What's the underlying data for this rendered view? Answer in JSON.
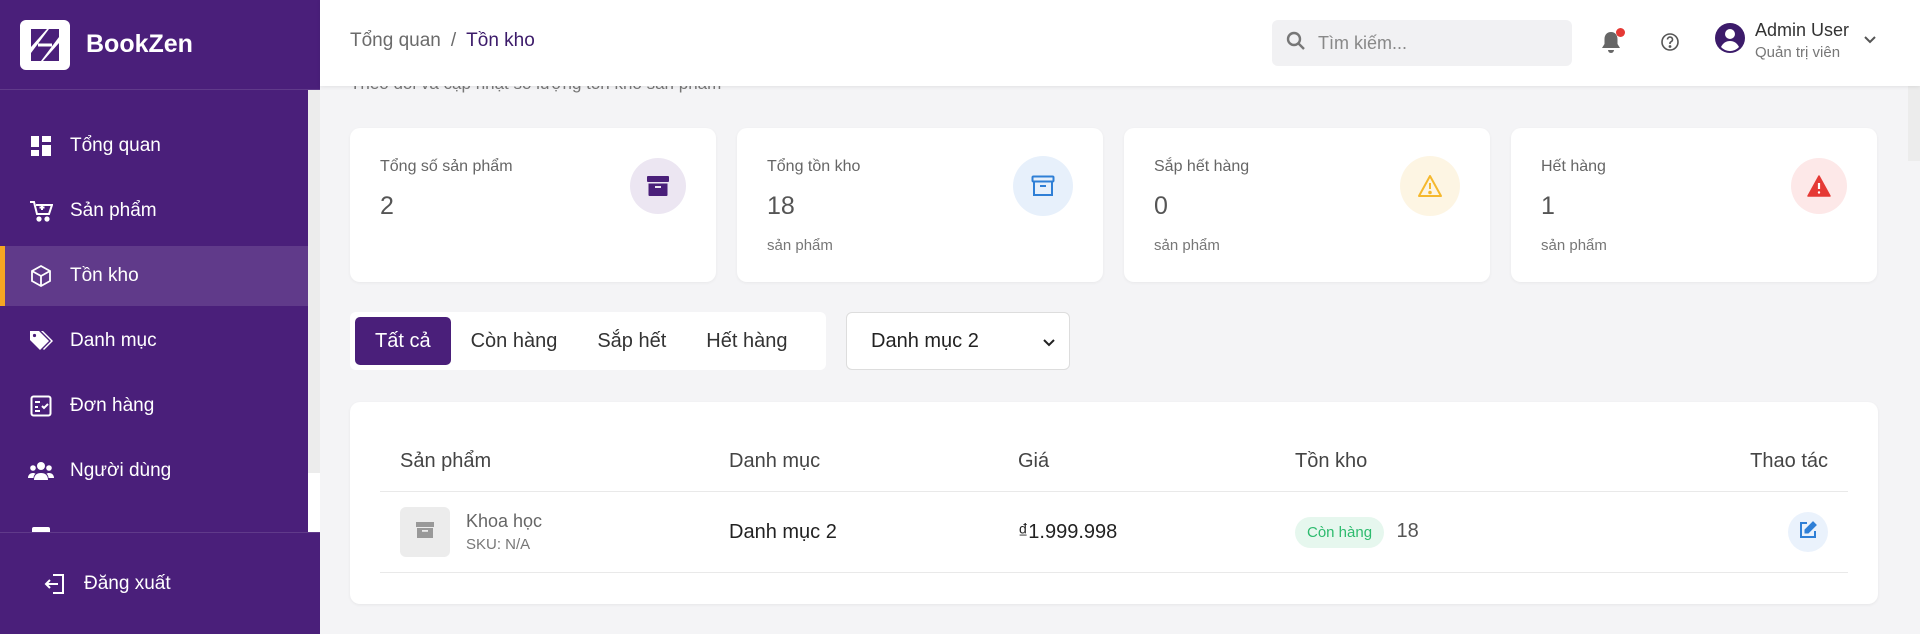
{
  "brand": {
    "name": "BookZen"
  },
  "sidebar": {
    "items": [
      {
        "label": "Tổng quan",
        "icon": "dashboard-icon",
        "active": false
      },
      {
        "label": "Sản phẩm",
        "icon": "cart-icon",
        "active": false
      },
      {
        "label": "Tồn kho",
        "icon": "box-icon",
        "active": true
      },
      {
        "label": "Danh mục",
        "icon": "tags-icon",
        "active": false
      },
      {
        "label": "Đơn hàng",
        "icon": "checklist-icon",
        "active": false
      },
      {
        "label": "Người dùng",
        "icon": "users-icon",
        "active": false
      }
    ],
    "logout_label": "Đăng xuất"
  },
  "header": {
    "breadcrumb": {
      "parent": "Tổng quan",
      "separator": "/",
      "current": "Tồn kho"
    },
    "search_placeholder": "Tìm kiếm...",
    "user": {
      "name": "Admin User",
      "role": "Quản trị viên"
    }
  },
  "page": {
    "subtitle": "Theo dõi và cập nhật số lượng tồn kho sản phẩm"
  },
  "stats": [
    {
      "label": "Tổng số sản phẩm",
      "value": "2",
      "unit": "",
      "icon": "archive-icon"
    },
    {
      "label": "Tổng tồn kho",
      "value": "18",
      "unit": "sản phẩm",
      "icon": "archive-outline-icon"
    },
    {
      "label": "Sắp hết hàng",
      "value": "0",
      "unit": "sản phẩm",
      "icon": "warning-icon"
    },
    {
      "label": "Hết hàng",
      "value": "1",
      "unit": "sản phẩm",
      "icon": "alert-icon"
    }
  ],
  "filters": {
    "tabs": [
      "Tất cả",
      "Còn hàng",
      "Sắp hết",
      "Hết hàng"
    ],
    "active_tab": "Tất cả",
    "category_selected": "Danh mục 2"
  },
  "table": {
    "headers": [
      "Sản phẩm",
      "Danh mục",
      "Giá",
      "Tồn kho",
      "Thao tác"
    ],
    "rows": [
      {
        "name": "Khoa học",
        "sku": "SKU: N/A",
        "category": "Danh mục 2",
        "price": "₫1.999.998",
        "status": "Còn hàng",
        "stock": "18"
      }
    ]
  },
  "colors": {
    "primary": "#4a1f7a",
    "accent": "#f5a623",
    "success": "#2dbb6e",
    "warning": "#f5b82e",
    "danger": "#e53935"
  }
}
